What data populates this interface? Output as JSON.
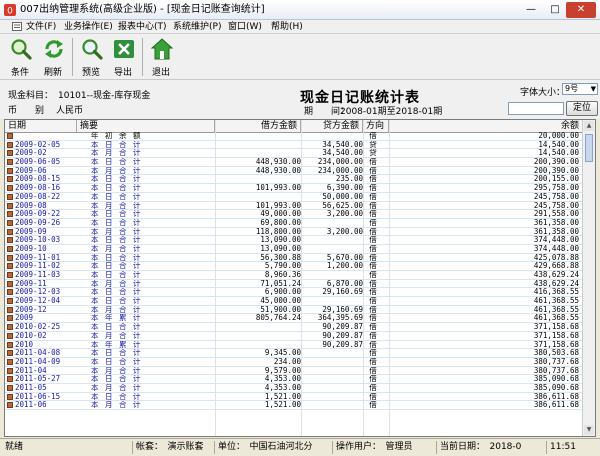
{
  "window": {
    "title": "007出纳管理系统(高级企业版) - [现金日记账查询统计]",
    "min_glyph": "—",
    "max_glyph": "□",
    "close_glyph": "✕"
  },
  "menu": [
    "文件(F)",
    "业务操作(E)",
    "报表中心(T)",
    "系统维护(P)",
    "窗口(W)",
    "帮助(H)"
  ],
  "toolbar": {
    "condition": "条件",
    "refresh": "刷新",
    "preview": "预览",
    "export": "导出",
    "exit": "退出"
  },
  "report": {
    "title": "现金日记账统计表",
    "account_label": "现金科目：",
    "account_value": "10101--现金-库存现金",
    "currency_label": "币　　别",
    "currency_value": "人民币",
    "period_label": "期　　间：",
    "period_value": "2008-01期至2018-01期",
    "fontsize_label": "字体大小：",
    "fontsize_value": "9号",
    "locate_label": "定位",
    "search_value": ""
  },
  "table": {
    "columns": [
      "日期",
      "摘要",
      "借方金额",
      "贷方金额",
      "方向",
      "余额"
    ],
    "rows": [
      {
        "date": "",
        "summary": "年 初 余 额",
        "debit": "",
        "credit": "",
        "dir": "借",
        "balance": "20,000.00",
        "black": true
      },
      {
        "date": "2009-02-05",
        "summary": "本 日 合 计",
        "debit": "",
        "credit": "34,540.00",
        "dir": "贷",
        "balance": "14,540.00"
      },
      {
        "date": "2009-02",
        "summary": "本 月 合 计",
        "debit": "",
        "credit": "34,540.00",
        "dir": "贷",
        "balance": "14,540.00"
      },
      {
        "date": "2009-06-05",
        "summary": "本 日 合 计",
        "debit": "448,930.00",
        "credit": "234,000.00",
        "dir": "借",
        "balance": "200,390.00"
      },
      {
        "date": "2009-06",
        "summary": "本 月 合 计",
        "debit": "448,930.00",
        "credit": "234,000.00",
        "dir": "借",
        "balance": "200,390.00"
      },
      {
        "date": "2009-08-15",
        "summary": "本 日 合 计",
        "debit": "",
        "credit": "235.00",
        "dir": "借",
        "balance": "200,155.00"
      },
      {
        "date": "2009-08-16",
        "summary": "本 日 合 计",
        "debit": "101,993.00",
        "credit": "6,390.00",
        "dir": "借",
        "balance": "295,758.00"
      },
      {
        "date": "2009-08-22",
        "summary": "本 日 合 计",
        "debit": "",
        "credit": "50,000.00",
        "dir": "借",
        "balance": "245,758.00"
      },
      {
        "date": "2009-08",
        "summary": "本 月 合 计",
        "debit": "101,993.00",
        "credit": "56,625.00",
        "dir": "借",
        "balance": "245,758.00"
      },
      {
        "date": "2009-09-22",
        "summary": "本 日 合 计",
        "debit": "49,000.00",
        "credit": "3,200.00",
        "dir": "借",
        "balance": "291,558.00"
      },
      {
        "date": "2009-09-26",
        "summary": "本 日 合 计",
        "debit": "69,800.00",
        "credit": "",
        "dir": "借",
        "balance": "361,358.00"
      },
      {
        "date": "2009-09",
        "summary": "本 月 合 计",
        "debit": "118,800.00",
        "credit": "3,200.00",
        "dir": "借",
        "balance": "361,358.00"
      },
      {
        "date": "2009-10-03",
        "summary": "本 日 合 计",
        "debit": "13,090.00",
        "credit": "",
        "dir": "借",
        "balance": "374,448.00"
      },
      {
        "date": "2009-10",
        "summary": "本 月 合 计",
        "debit": "13,090.00",
        "credit": "",
        "dir": "借",
        "balance": "374,448.00"
      },
      {
        "date": "2009-11-01",
        "summary": "本 日 合 计",
        "debit": "56,300.88",
        "credit": "5,670.00",
        "dir": "借",
        "balance": "425,078.88"
      },
      {
        "date": "2009-11-02",
        "summary": "本 日 合 计",
        "debit": "5,790.00",
        "credit": "1,200.00",
        "dir": "借",
        "balance": "429,668.88"
      },
      {
        "date": "2009-11-03",
        "summary": "本 日 合 计",
        "debit": "8,960.36",
        "credit": "",
        "dir": "借",
        "balance": "438,629.24"
      },
      {
        "date": "2009-11",
        "summary": "本 月 合 计",
        "debit": "71,051.24",
        "credit": "6,870.00",
        "dir": "借",
        "balance": "438,629.24"
      },
      {
        "date": "2009-12-03",
        "summary": "本 日 合 计",
        "debit": "6,900.00",
        "credit": "29,160.69",
        "dir": "借",
        "balance": "416,368.55"
      },
      {
        "date": "2009-12-04",
        "summary": "本 日 合 计",
        "debit": "45,000.00",
        "credit": "",
        "dir": "借",
        "balance": "461,368.55"
      },
      {
        "date": "2009-12",
        "summary": "本 月 合 计",
        "debit": "51,900.00",
        "credit": "29,160.69",
        "dir": "借",
        "balance": "461,368.55"
      },
      {
        "date": "2009",
        "summary": "本 年 累 计",
        "debit": "805,764.24",
        "credit": "364,395.69",
        "dir": "借",
        "balance": "461,368.55"
      },
      {
        "date": "2010-02-25",
        "summary": "本 日 合 计",
        "debit": "",
        "credit": "90,209.87",
        "dir": "借",
        "balance": "371,158.68"
      },
      {
        "date": "2010-02",
        "summary": "本 月 合 计",
        "debit": "",
        "credit": "90,209.87",
        "dir": "借",
        "balance": "371,158.68"
      },
      {
        "date": "2010",
        "summary": "本 年 累 计",
        "debit": "",
        "credit": "90,209.87",
        "dir": "借",
        "balance": "371,158.68"
      },
      {
        "date": "2011-04-08",
        "summary": "本 日 合 计",
        "debit": "9,345.00",
        "credit": "",
        "dir": "借",
        "balance": "380,503.68"
      },
      {
        "date": "2011-04-09",
        "summary": "本 日 合 计",
        "debit": "234.00",
        "credit": "",
        "dir": "借",
        "balance": "380,737.68"
      },
      {
        "date": "2011-04",
        "summary": "本 月 合 计",
        "debit": "9,579.00",
        "credit": "",
        "dir": "借",
        "balance": "380,737.68"
      },
      {
        "date": "2011-05-27",
        "summary": "本 日 合 计",
        "debit": "4,353.00",
        "credit": "",
        "dir": "借",
        "balance": "385,090.68"
      },
      {
        "date": "2011-05",
        "summary": "本 月 合 计",
        "debit": "4,353.00",
        "credit": "",
        "dir": "借",
        "balance": "385,090.68"
      },
      {
        "date": "2011-06-15",
        "summary": "本 日 合 计",
        "debit": "1,521.00",
        "credit": "",
        "dir": "借",
        "balance": "386,611.68"
      },
      {
        "date": "2011-06",
        "summary": "本 月 合 计",
        "debit": "1,521.00",
        "credit": "",
        "dir": "借",
        "balance": "386,611.68"
      }
    ]
  },
  "status": {
    "ready": "就绪",
    "book": "帐套：　演示账套",
    "unit": "单位：　中国石油河北分",
    "user": "操作用户：　管理员",
    "date": "当前日期：　2018-0",
    "time": "11:51"
  }
}
